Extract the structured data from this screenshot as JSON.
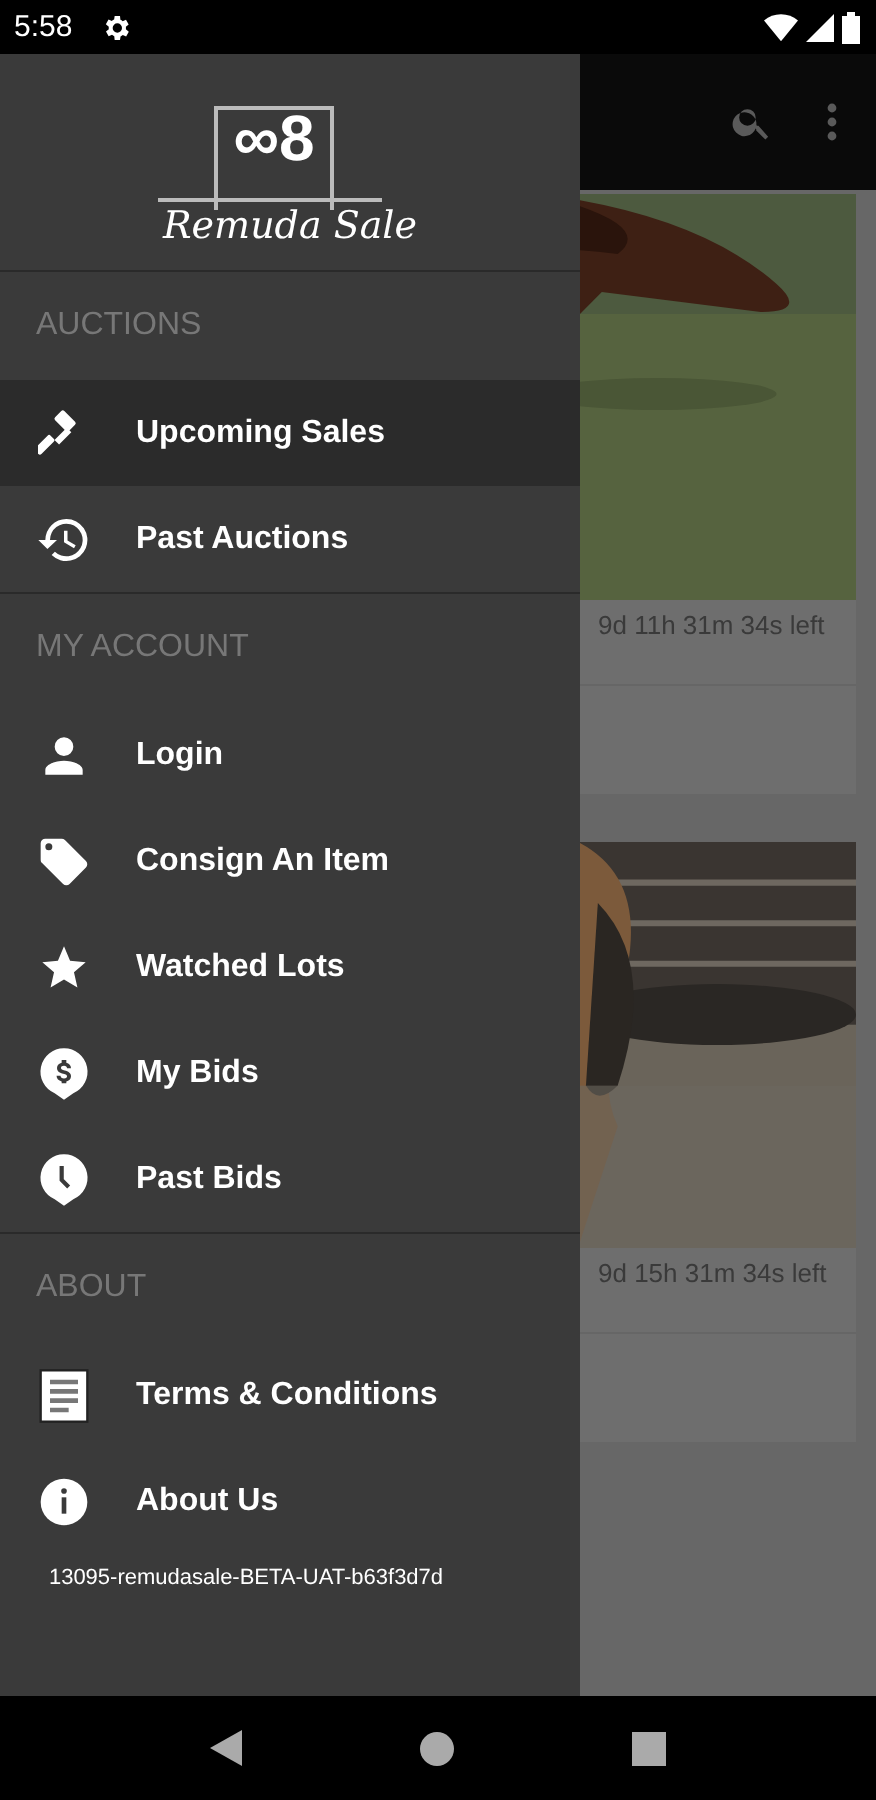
{
  "status_bar": {
    "time": "5:58"
  },
  "listings": [
    {
      "kind": "picture",
      "time_left": "9d 11h 31m 34s left"
    },
    {
      "kind": "picture",
      "time_left": "9d 15h 31m 34s left"
    }
  ],
  "drawer": {
    "logo": {
      "mark": "∞8",
      "name": "Remuda Sale"
    },
    "sections": [
      {
        "title": "AUCTIONS",
        "items": [
          {
            "label": "Upcoming Sales",
            "selected": true
          },
          {
            "label": "Past Auctions",
            "selected": false
          }
        ]
      },
      {
        "title": "MY ACCOUNT",
        "items": [
          {
            "label": "Login",
            "selected": false
          },
          {
            "label": "Consign An Item",
            "selected": false
          },
          {
            "label": "Watched Lots",
            "selected": false
          },
          {
            "label": "My Bids",
            "selected": false
          },
          {
            "label": "Past Bids",
            "selected": false
          }
        ]
      },
      {
        "title": "ABOUT",
        "items": [
          {
            "label": "Terms & Conditions",
            "selected": false
          },
          {
            "label": "About Us",
            "selected": false
          }
        ]
      }
    ],
    "version": "13095-remudasale-BETA-UAT-b63f3d7d"
  }
}
